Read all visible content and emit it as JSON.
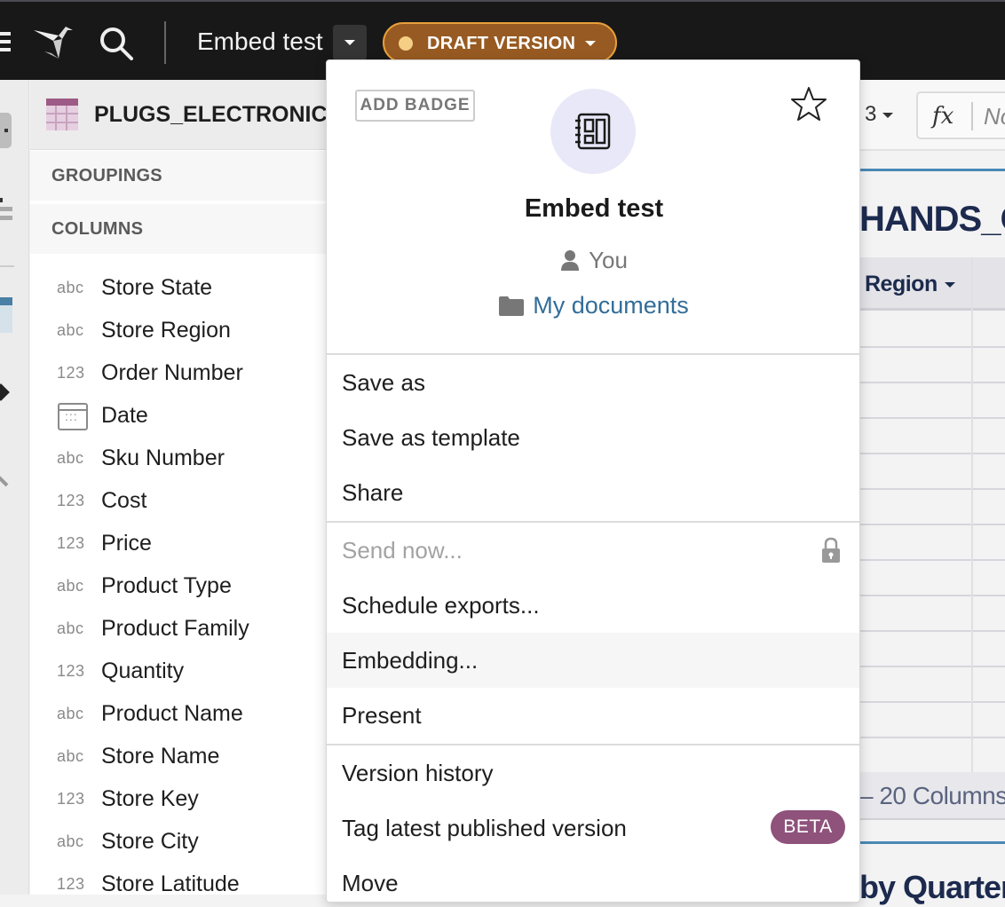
{
  "topbar": {
    "doc_title": "Embed test",
    "draft_label": "DRAFT VERSION",
    "colors": {
      "bar": "#181818",
      "draft_bg": "#975a22",
      "draft_border": "#e8a03a",
      "draft_dot": "#f6cf86"
    }
  },
  "panel": {
    "title": "PLUGS_ELECTRONICS",
    "groupings_label": "GROUPINGS",
    "columns_label": "COLUMNS",
    "columns": [
      {
        "type": "abc",
        "name": "Store State"
      },
      {
        "type": "abc",
        "name": "Store Region"
      },
      {
        "type": "123",
        "name": "Order Number"
      },
      {
        "type": "date",
        "name": "Date"
      },
      {
        "type": "abc",
        "name": "Sku Number"
      },
      {
        "type": "123",
        "name": "Cost"
      },
      {
        "type": "123",
        "name": "Price"
      },
      {
        "type": "abc",
        "name": "Product Type"
      },
      {
        "type": "abc",
        "name": "Product Family"
      },
      {
        "type": "123",
        "name": "Quantity"
      },
      {
        "type": "abc",
        "name": "Product Name"
      },
      {
        "type": "abc",
        "name": "Store Name"
      },
      {
        "type": "123",
        "name": "Store Key"
      },
      {
        "type": "abc",
        "name": "Store City"
      },
      {
        "type": "123",
        "name": "Store Latitude"
      }
    ]
  },
  "workbook": {
    "toolbar_value": "3",
    "formula_label": "fx",
    "formula_placeholder": "No",
    "sheet_title": "HANDS_ON_",
    "column_header": "Region",
    "footer_text": "– 20 Columns",
    "next_title": "by Quarter ("
  },
  "menu": {
    "add_badge": "ADD BADGE",
    "title": "Embed test",
    "owner": "You",
    "folder": "My documents",
    "groups": [
      [
        {
          "label": "Save as"
        },
        {
          "label": "Save as template"
        },
        {
          "label": "Share"
        }
      ],
      [
        {
          "label": "Send now...",
          "disabled": true,
          "locked": true
        },
        {
          "label": "Schedule exports..."
        },
        {
          "label": "Embedding...",
          "hovered": true
        },
        {
          "label": "Present"
        }
      ],
      [
        {
          "label": "Version history"
        },
        {
          "label": "Tag latest published version",
          "badge": "BETA"
        },
        {
          "label": "Move"
        }
      ]
    ],
    "colors": {
      "link": "#336d99",
      "beta": "#8e527b",
      "avatar_bg": "#e9e8f8"
    }
  }
}
